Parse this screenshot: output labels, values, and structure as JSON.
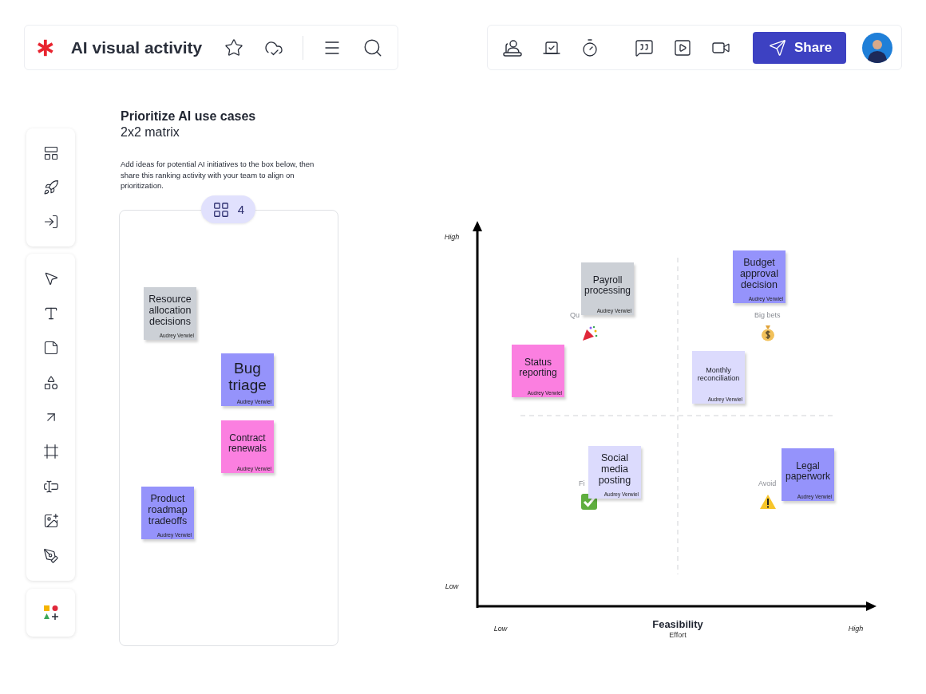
{
  "header": {
    "title": "AI visual activity"
  },
  "share_button": {
    "label": "Share"
  },
  "activity": {
    "title": "Prioritize AI use cases",
    "subtitle": "2x2 matrix",
    "description": "Add ideas for potential AI initiatives to the box below, then share this ranking activity with your team to align on prioritization.",
    "count": "4",
    "notes": [
      {
        "text": "Resource allocation decisions",
        "author": "Audrey Verwiel",
        "color": "#ccd0d6"
      },
      {
        "text": "Bug triage",
        "author": "Audrey Verwiel",
        "color": "#9593fb"
      },
      {
        "text": "Contract renewals",
        "author": "Audrey Verwiel",
        "color": "#fb7fe0"
      },
      {
        "text": "Product roadmap tradeoffs",
        "author": "Audrey Verwiel",
        "color": "#9593fb"
      }
    ]
  },
  "matrix": {
    "y_high": "High",
    "y_low": "Low",
    "x_low": "Low",
    "x_high": "High",
    "x_title": "Feasibility",
    "x_subtitle": "Effort",
    "quadrants": [
      {
        "label": "Qu",
        "kind": "party"
      },
      {
        "label": "Big bets",
        "kind": "money"
      },
      {
        "label": "Fi",
        "kind": "check"
      },
      {
        "label": "Avoid",
        "kind": "warning"
      }
    ],
    "notes": [
      {
        "text": "Payroll processing",
        "author": "Audrey Verwiel",
        "color": "#ccd0d6"
      },
      {
        "text": "Budget approval decision",
        "author": "Audrey Verwiel",
        "color": "#9593fb"
      },
      {
        "text": "Status reporting",
        "author": "Audrey Verwiel",
        "color": "#fb7fe0"
      },
      {
        "text": "Monthly reconciliation",
        "author": "Audrey Verwiel",
        "color": "#dcdbfd"
      },
      {
        "text": "Social media posting",
        "author": "Audrey Verwiel",
        "color": "#dcdbfd"
      },
      {
        "text": "Legal paperwork",
        "author": "Audrey Verwiel",
        "color": "#9593fb"
      }
    ]
  }
}
